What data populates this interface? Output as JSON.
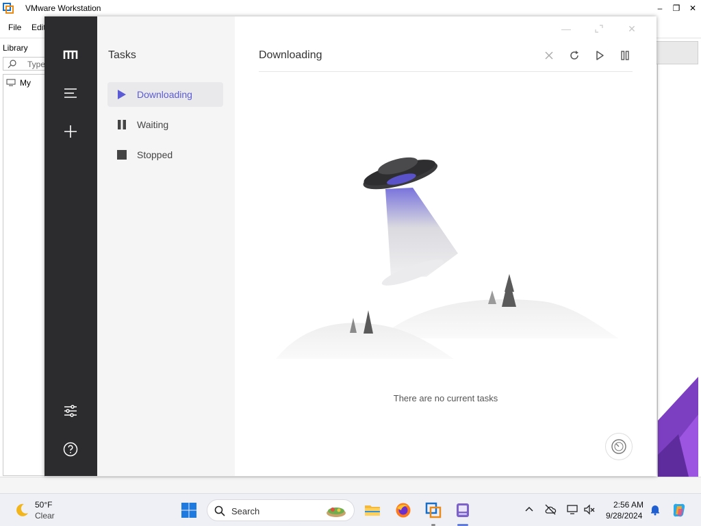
{
  "vmware": {
    "title": "VMware Workstation",
    "menu": [
      "File",
      "Edit"
    ],
    "library_title": "Library",
    "search_placeholder": "Type",
    "tree_item": "My"
  },
  "motrix": {
    "tasks_title": "Tasks",
    "task_filters": [
      {
        "label": "Downloading",
        "icon": "play-icon",
        "active": true
      },
      {
        "label": "Waiting",
        "icon": "pause-icon",
        "active": false
      },
      {
        "label": "Stopped",
        "icon": "stop-icon",
        "active": false
      }
    ],
    "main_title": "Downloading",
    "empty_message": "There are no current tasks",
    "accent_color": "#5b5bd6",
    "sidebar_color": "#2c2c2e"
  },
  "taskbar": {
    "weather_temp": "50°F",
    "weather_desc": "Clear",
    "search_placeholder": "Search",
    "clock_time": "2:56 AM",
    "clock_date": "9/28/2024"
  }
}
